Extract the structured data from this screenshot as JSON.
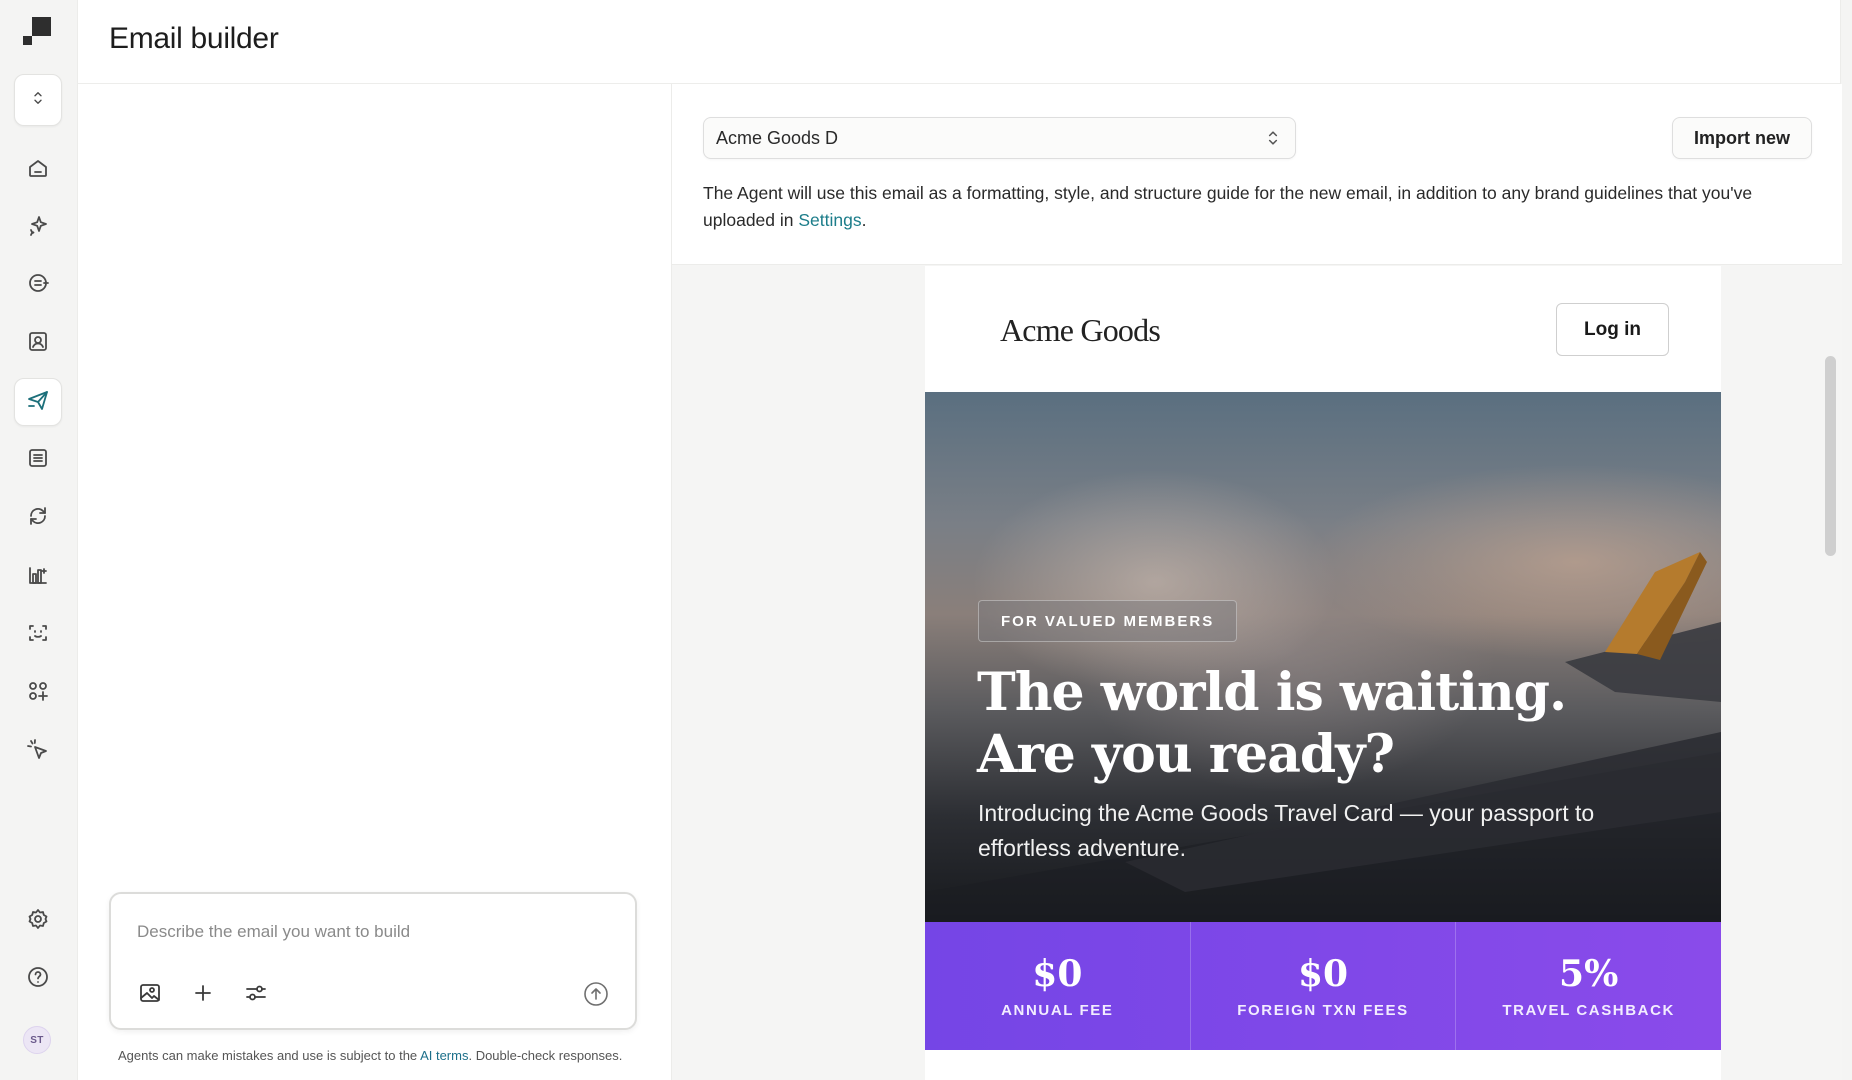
{
  "header": {
    "title": "Email builder"
  },
  "sidebar": {
    "items": [
      {
        "name": "workspace-switcher",
        "icon": "chevron-updown-icon"
      },
      {
        "name": "home",
        "icon": "home-icon"
      },
      {
        "name": "ai-agent",
        "icon": "sparkle-icon"
      },
      {
        "name": "campaigns",
        "icon": "broadcast-icon"
      },
      {
        "name": "contacts",
        "icon": "contact-card-icon"
      },
      {
        "name": "email-builder",
        "icon": "paper-plane-icon",
        "active": true
      },
      {
        "name": "lists",
        "icon": "list-icon"
      },
      {
        "name": "automations",
        "icon": "refresh-icon"
      },
      {
        "name": "analytics",
        "icon": "chart-icon"
      },
      {
        "name": "audiences",
        "icon": "face-scan-icon"
      },
      {
        "name": "apps",
        "icon": "apps-icon"
      },
      {
        "name": "tracking",
        "icon": "cursor-click-icon"
      },
      {
        "name": "settings",
        "icon": "gear-icon"
      },
      {
        "name": "help",
        "icon": "help-icon"
      }
    ],
    "avatar_initials": "ST"
  },
  "composer": {
    "placeholder": "Describe the email you want to build",
    "tools": [
      "image-upload-icon",
      "plus-icon",
      "sliders-icon"
    ],
    "send_icon": "arrow-up-circle-icon"
  },
  "disclaimer": {
    "before": "Agents can make mistakes and use is subject to the ",
    "link": "AI terms",
    "after": ". Double-check responses."
  },
  "preview": {
    "selected_template": "Acme Goods D",
    "import_label": "Import new",
    "helper_text": "The Agent will use this email as a formatting, style, and structure guide for the new email, in addition to any brand guidelines that you've uploaded in ",
    "helper_link": "Settings",
    "helper_end": "."
  },
  "email": {
    "logo": "Acme Goods",
    "login_label": "Log in",
    "badge": "FOR VALUED MEMBERS",
    "headline_line1": "The world is waiting.",
    "headline_line2": "Are you ready?",
    "subhead": "Introducing the Acme Goods Travel Card — your passport to effortless adventure.",
    "stats": [
      {
        "value": "$0",
        "label": "ANNUAL FEE"
      },
      {
        "value": "$0",
        "label": "FOREIGN TXN FEES"
      },
      {
        "value": "5%",
        "label": "TRAVEL CASHBACK"
      }
    ]
  },
  "colors": {
    "accent_teal": "#1c7d8a",
    "stats_purple": "#7c47e8"
  }
}
